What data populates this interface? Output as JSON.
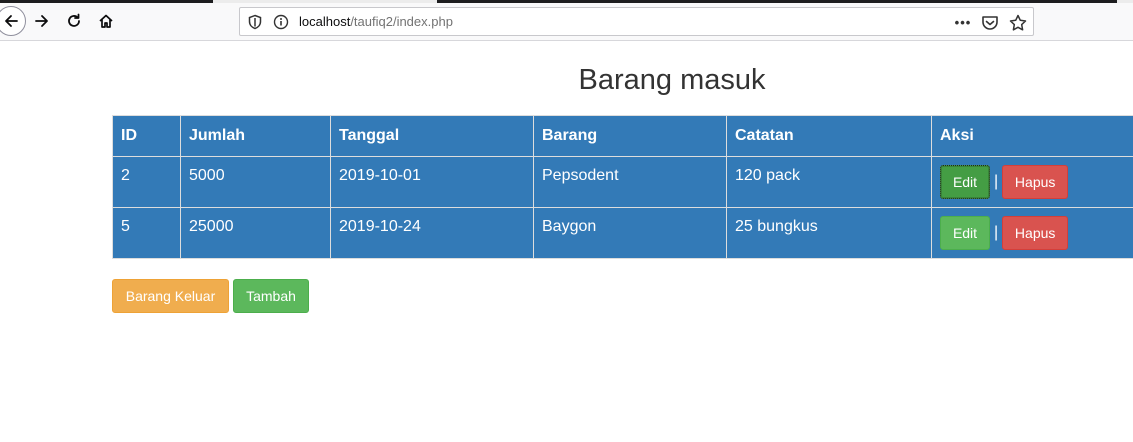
{
  "browser": {
    "url_host": "localhost",
    "url_path": "/taufiq2/index.php",
    "url_more": "•••"
  },
  "page": {
    "title": "Barang masuk"
  },
  "table": {
    "headers": {
      "id": "ID",
      "jumlah": "Jumlah",
      "tanggal": "Tanggal",
      "barang": "Barang",
      "catatan": "Catatan",
      "aksi": "Aksi"
    },
    "rows": [
      {
        "id": "2",
        "jumlah": "5000",
        "tanggal": "2019-10-01",
        "barang": "Pepsodent",
        "catatan": "120 pack",
        "edit_label": "Edit",
        "separator": "|",
        "hapus_label": "Hapus"
      },
      {
        "id": "5",
        "jumlah": "25000",
        "tanggal": "2019-10-24",
        "barang": "Baygon",
        "catatan": "25 bungkus",
        "edit_label": "Edit",
        "separator": "|",
        "hapus_label": "Hapus"
      }
    ]
  },
  "actions": {
    "barang_keluar_label": "Barang Keluar",
    "tambah_label": "Tambah"
  },
  "colors": {
    "table_bg": "#337ab7",
    "success": "#5cb85c",
    "danger": "#d9534f",
    "warning": "#f0ad4e"
  },
  "icons": [
    "back-arrow-icon",
    "forward-arrow-icon",
    "reload-icon",
    "home-icon",
    "shield-icon",
    "info-icon",
    "pocket-icon",
    "star-icon"
  ]
}
